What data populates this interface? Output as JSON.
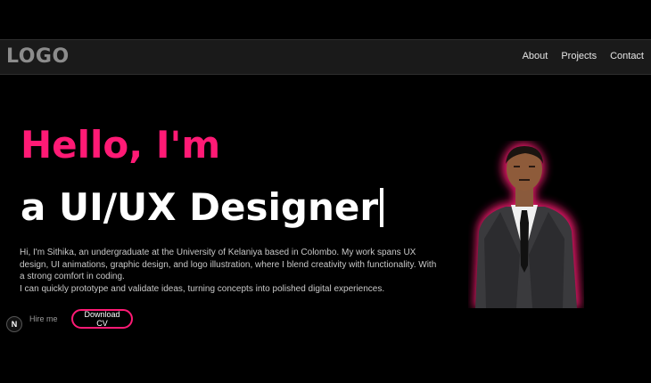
{
  "header": {
    "logo": "LOGO",
    "nav": [
      "About",
      "Projects",
      "Contact"
    ]
  },
  "hero": {
    "greeting": "Hello, I'm",
    "role": "a UI/UX Designer",
    "bio": [
      "Hi, I'm Sithika, an undergraduate at the University of Kelaniya based in Colombo. My work spans UX design, UI animations, graphic design, and logo illustration, where I blend creativity with functionality. With a strong comfort in coding.",
      "I can quickly prototype and validate ideas, turning concepts into polished digital experiences."
    ],
    "hire_label": "Hire me",
    "cv_label": "Download CV"
  },
  "badge": {
    "letter": "N",
    "icon": "nextjs-badge-icon"
  },
  "colors": {
    "accent": "#ff1a75",
    "background": "#000000",
    "navbar": "#1a1a1a"
  }
}
